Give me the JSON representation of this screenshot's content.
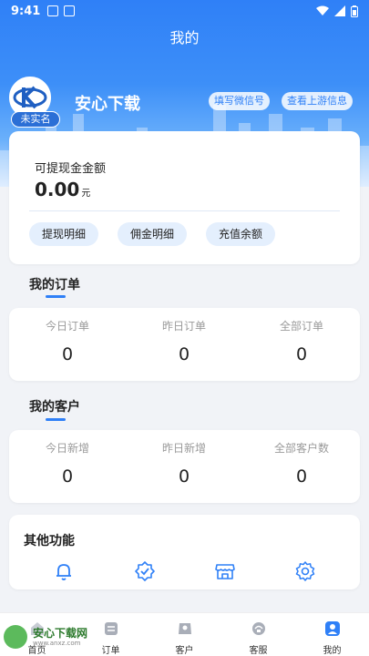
{
  "status_bar": {
    "time": "9:41"
  },
  "header": {
    "title": "我的"
  },
  "profile": {
    "badge": "未实名",
    "app_name": "安心下载",
    "fill_wechat": "填写微信号",
    "view_upstream": "查看上游信息"
  },
  "wallet": {
    "label": "可提现金金额",
    "amount": "0.00",
    "unit": "元",
    "actions": [
      "提现明细",
      "佣金明细",
      "充值余额"
    ]
  },
  "orders": {
    "title": "我的订单",
    "stats": [
      {
        "label": "今日订单",
        "value": "0"
      },
      {
        "label": "昨日订单",
        "value": "0"
      },
      {
        "label": "全部订单",
        "value": "0"
      }
    ]
  },
  "customers": {
    "title": "我的客户",
    "stats": [
      {
        "label": "今日新增",
        "value": "0"
      },
      {
        "label": "昨日新增",
        "value": "0"
      },
      {
        "label": "全部客户数",
        "value": "0"
      }
    ]
  },
  "other": {
    "title": "其他功能",
    "icons": [
      "bell-icon",
      "badge-check-icon",
      "store-icon",
      "settings-gear-icon"
    ]
  },
  "bottom_nav": {
    "items": [
      {
        "label": "首页",
        "icon": "home-icon"
      },
      {
        "label": "订单",
        "icon": "order-icon"
      },
      {
        "label": "客户",
        "icon": "customer-icon"
      },
      {
        "label": "客服",
        "icon": "service-icon"
      },
      {
        "label": "我的",
        "icon": "profile-icon",
        "active": true
      }
    ]
  },
  "watermark": {
    "text": "安心下载网",
    "url": "www.anxz.com"
  },
  "colors": {
    "primary": "#2f80f7",
    "chip_bg": "#e4effd",
    "page_bg": "#f1f3f7"
  }
}
